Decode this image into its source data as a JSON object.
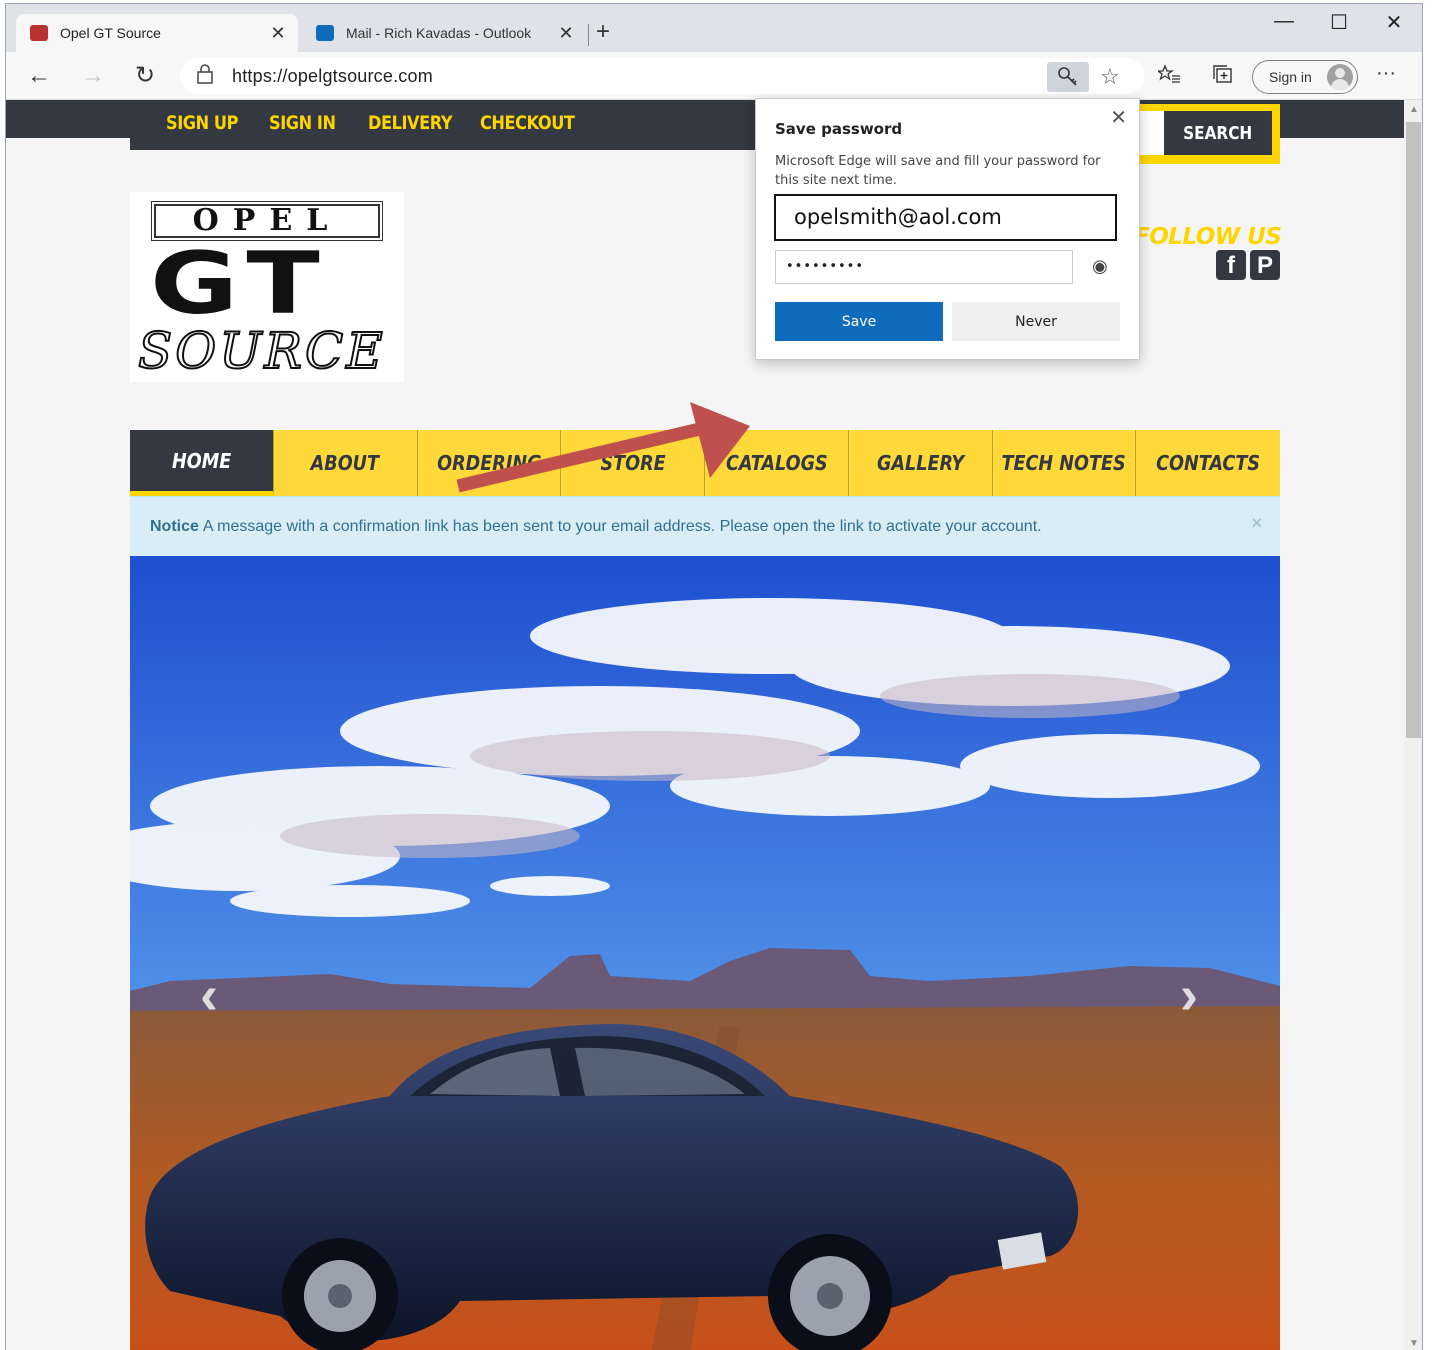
{
  "browser": {
    "tabs": [
      {
        "title": "Opel GT Source",
        "active": true,
        "favicon_color": "#b83232"
      },
      {
        "title": "Mail - Rich Kavadas - Outlook",
        "active": false,
        "favicon_color": "#0f6cbd"
      }
    ],
    "new_tab": "+",
    "close_glyph": "✕",
    "window_controls": {
      "minimize": "—",
      "maximize": "☐",
      "close": "✕"
    },
    "nav": {
      "back": "←",
      "forward": "→",
      "refresh": "↻"
    },
    "url": "https://opelgtsource.com",
    "sign_in_label": "Sign in",
    "more": "···"
  },
  "site": {
    "top_links": [
      "SIGN UP",
      "SIGN IN",
      "DELIVERY",
      "CHECKOUT"
    ],
    "search_button": "SEARCH",
    "logo": {
      "line1": "OPEL",
      "line2": "GT",
      "line3": "SOURCE"
    },
    "follow_us": "FOLLOW US",
    "social": [
      "f",
      "P"
    ],
    "main_nav": [
      {
        "label": "HOME",
        "active": true
      },
      {
        "label": "ABOUT",
        "active": false
      },
      {
        "label": "ORDERING",
        "active": false
      },
      {
        "label": "STORE",
        "active": false
      },
      {
        "label": "CATALOGS",
        "active": false
      },
      {
        "label": "GALLERY",
        "active": false
      },
      {
        "label": "TECH NOTES",
        "active": false
      },
      {
        "label": "CONTACTS",
        "active": false
      }
    ],
    "notice": {
      "label": "Notice",
      "text": "A message with a confirmation link has been sent to your email address. Please open the link to activate your account.",
      "close": "×"
    },
    "carousel": {
      "prev": "‹",
      "next": "›"
    },
    "colors": {
      "accent_yellow": "#ffd500",
      "dark": "#333841",
      "notice_bg": "#d9edf7",
      "arrow_red": "#c0504d"
    }
  },
  "password_popup": {
    "title": "Save password",
    "description": "Microsoft Edge will save and fill your password for this site next time.",
    "username": "opelsmith@aol.com",
    "password_mask": "•••••••••",
    "save_label": "Save",
    "never_label": "Never",
    "close": "✕",
    "eye": "◉"
  }
}
